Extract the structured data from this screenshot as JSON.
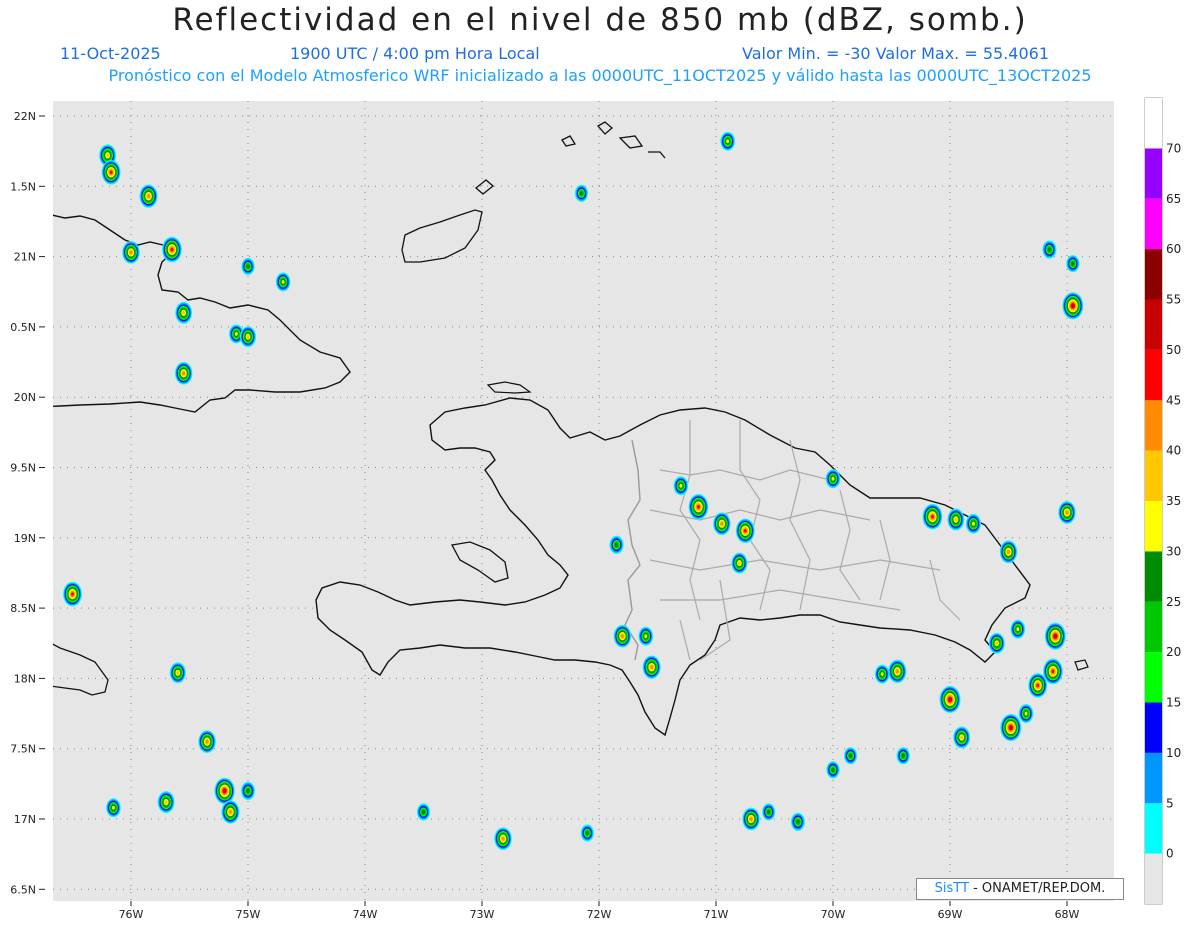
{
  "header": {
    "title": "Reflectividad en el nivel de 850 mb (dBZ, somb.)",
    "date": "11-Oct-2025",
    "time": "1900 UTC / 4:00 pm Hora Local",
    "minmax": "Valor Min. = -30  Valor Max. = 55.4061",
    "subtitle": "Pronóstico con el Modelo Atmosferico WRF inicializado a las 0000UTC_11OCT2025 y válido hasta las  0000UTC_13OCT2025"
  },
  "axes": {
    "lat_labels": [
      "22N",
      "1.5N",
      "21N",
      "0.5N",
      "20N",
      "9.5N",
      "19N",
      "8.5N",
      "18N",
      "7.5N",
      "17N",
      "6.5N"
    ],
    "lon_labels": [
      "76W",
      "75W",
      "74W",
      "73W",
      "72W",
      "71W",
      "70W",
      "69W",
      "68W"
    ]
  },
  "colorbar": {
    "labels": [
      "0",
      "5",
      "10",
      "15",
      "20",
      "25",
      "30",
      "35",
      "40",
      "45",
      "50",
      "55",
      "60",
      "65",
      "70"
    ],
    "colors": [
      "#e6e6e6",
      "#00ffff",
      "#0096ff",
      "#0000ff",
      "#00ff00",
      "#00c800",
      "#008c00",
      "#ffff00",
      "#ffc800",
      "#ff8c00",
      "#ff0000",
      "#c80000",
      "#8c0000",
      "#ff00ff",
      "#9600ff",
      "#ffffff"
    ]
  },
  "credit": {
    "brand": "SisTT",
    "text": " - ONAMET/REP.DOM."
  },
  "cells": [
    {
      "lon": -76.2,
      "lat": 21.72,
      "dbz": 38
    },
    {
      "lon": -76.17,
      "lat": 21.6,
      "dbz": 45
    },
    {
      "lon": -75.85,
      "lat": 21.43,
      "dbz": 42
    },
    {
      "lon": -76.0,
      "lat": 21.03,
      "dbz": 40
    },
    {
      "lon": -75.65,
      "lat": 21.05,
      "dbz": 48
    },
    {
      "lon": -75.55,
      "lat": 20.6,
      "dbz": 38
    },
    {
      "lon": -75.1,
      "lat": 20.45,
      "dbz": 30
    },
    {
      "lon": -75.0,
      "lat": 20.43,
      "dbz": 35
    },
    {
      "lon": -75.55,
      "lat": 20.17,
      "dbz": 40
    },
    {
      "lon": -74.7,
      "lat": 20.82,
      "dbz": 30
    },
    {
      "lon": -75.0,
      "lat": 20.93,
      "dbz": 25
    },
    {
      "lon": -76.5,
      "lat": 18.6,
      "dbz": 45
    },
    {
      "lon": -75.6,
      "lat": 18.04,
      "dbz": 35
    },
    {
      "lon": -75.35,
      "lat": 17.55,
      "dbz": 40
    },
    {
      "lon": -75.2,
      "lat": 17.2,
      "dbz": 50
    },
    {
      "lon": -75.15,
      "lat": 17.05,
      "dbz": 42
    },
    {
      "lon": -75.7,
      "lat": 17.12,
      "dbz": 38
    },
    {
      "lon": -76.15,
      "lat": 17.08,
      "dbz": 30
    },
    {
      "lon": -75.0,
      "lat": 17.2,
      "dbz": 28
    },
    {
      "lon": -73.5,
      "lat": 17.05,
      "dbz": 25
    },
    {
      "lon": -72.82,
      "lat": 16.86,
      "dbz": 40
    },
    {
      "lon": -72.1,
      "lat": 16.9,
      "dbz": 25
    },
    {
      "lon": -72.15,
      "lat": 21.45,
      "dbz": 25
    },
    {
      "lon": -70.9,
      "lat": 21.82,
      "dbz": 30
    },
    {
      "lon": -71.85,
      "lat": 18.95,
      "dbz": 28
    },
    {
      "lon": -71.8,
      "lat": 18.3,
      "dbz": 40
    },
    {
      "lon": -71.55,
      "lat": 18.08,
      "dbz": 42
    },
    {
      "lon": -71.6,
      "lat": 18.3,
      "dbz": 30
    },
    {
      "lon": -71.15,
      "lat": 19.22,
      "dbz": 48
    },
    {
      "lon": -70.95,
      "lat": 19.1,
      "dbz": 40
    },
    {
      "lon": -70.75,
      "lat": 19.05,
      "dbz": 45
    },
    {
      "lon": -70.8,
      "lat": 18.82,
      "dbz": 35
    },
    {
      "lon": -71.3,
      "lat": 19.37,
      "dbz": 30
    },
    {
      "lon": -70.0,
      "lat": 19.42,
      "dbz": 30
    },
    {
      "lon": -69.15,
      "lat": 19.15,
      "dbz": 48
    },
    {
      "lon": -68.95,
      "lat": 19.13,
      "dbz": 38
    },
    {
      "lon": -68.8,
      "lat": 19.1,
      "dbz": 32
    },
    {
      "lon": -68.5,
      "lat": 18.9,
      "dbz": 40
    },
    {
      "lon": -68.0,
      "lat": 19.18,
      "dbz": 40
    },
    {
      "lon": -67.95,
      "lat": 20.65,
      "dbz": 52
    },
    {
      "lon": -68.15,
      "lat": 21.05,
      "dbz": 28
    },
    {
      "lon": -67.95,
      "lat": 20.95,
      "dbz": 25
    },
    {
      "lon": -69.45,
      "lat": 18.05,
      "dbz": 42
    },
    {
      "lon": -69.58,
      "lat": 18.03,
      "dbz": 30
    },
    {
      "lon": -69.0,
      "lat": 17.85,
      "dbz": 52
    },
    {
      "lon": -68.9,
      "lat": 17.58,
      "dbz": 38
    },
    {
      "lon": -68.6,
      "lat": 18.25,
      "dbz": 35
    },
    {
      "lon": -68.42,
      "lat": 18.35,
      "dbz": 30
    },
    {
      "lon": -68.1,
      "lat": 18.3,
      "dbz": 52
    },
    {
      "lon": -68.12,
      "lat": 18.05,
      "dbz": 48
    },
    {
      "lon": -68.25,
      "lat": 17.95,
      "dbz": 45
    },
    {
      "lon": -68.48,
      "lat": 17.65,
      "dbz": 52
    },
    {
      "lon": -68.35,
      "lat": 17.75,
      "dbz": 30
    },
    {
      "lon": -70.3,
      "lat": 16.98,
      "dbz": 28
    },
    {
      "lon": -70.55,
      "lat": 17.05,
      "dbz": 25
    },
    {
      "lon": -70.7,
      "lat": 17.0,
      "dbz": 40
    },
    {
      "lon": -69.85,
      "lat": 17.45,
      "dbz": 25
    },
    {
      "lon": -69.4,
      "lat": 17.45,
      "dbz": 25
    },
    {
      "lon": -70.0,
      "lat": 17.35,
      "dbz": 25
    }
  ]
}
